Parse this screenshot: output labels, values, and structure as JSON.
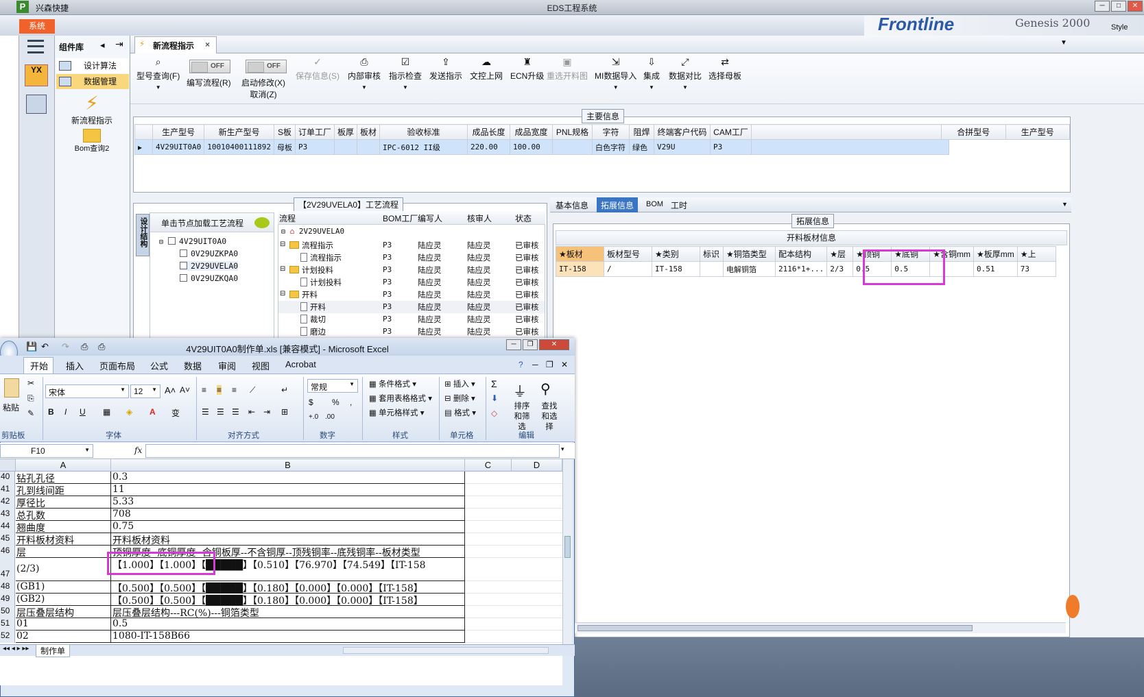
{
  "app": {
    "title": "EDS工程系统",
    "name": "兴森快捷",
    "system_button": "系统",
    "banner_text": "Frontline",
    "banner_sub": "Genesis 2000",
    "style_label": "Style"
  },
  "nav": {
    "library_label": "组件库",
    "items": [
      "设计算法",
      "数据管理"
    ],
    "launchers": [
      "新流程指示",
      "Bom查询2"
    ]
  },
  "tab": {
    "label": "新流程指示",
    "close": "×"
  },
  "toolbar": {
    "buttons": [
      {
        "label": "型号查询(F)",
        "icon": "search-icon"
      },
      {
        "label": "编写流程(R)",
        "icon": "toggle-off"
      },
      {
        "label": "启动修改(X)",
        "sub": "取消(Z)",
        "icon": "toggle-off"
      },
      {
        "label": "保存信息(S)",
        "icon": "check-icon",
        "disabled": true
      },
      {
        "label": "内部审核",
        "icon": "print-icon"
      },
      {
        "label": "指示检查",
        "icon": "check-box-icon"
      },
      {
        "label": "发送指示",
        "icon": "upload-icon"
      },
      {
        "label": "文控上网",
        "icon": "cloud-upload-icon"
      },
      {
        "label": "ECN升级",
        "icon": "ecn-icon"
      },
      {
        "label": "重选开料图",
        "icon": "image-icon",
        "disabled": true
      },
      {
        "label": "MI数据导入",
        "icon": "import-icon"
      },
      {
        "label": "集成",
        "icon": "download-icon"
      },
      {
        "label": "数据对比",
        "icon": "compare-icon"
      },
      {
        "label": "选择母板",
        "icon": "shuffle-icon"
      }
    ],
    "toggle_text": "OFF"
  },
  "main_info": {
    "title": "主要信息",
    "columns": [
      "生产型号",
      "新生产型号",
      "S板",
      "订单工厂",
      "板厚",
      "板材",
      "验收标准",
      "成品长度",
      "成品宽度",
      "PNL规格",
      "字符",
      "阻焊",
      "终端客户代码",
      "CAM工厂"
    ],
    "row": [
      "4V29UIT0A0",
      "10010400111892",
      "母板",
      "P3",
      "",
      "",
      "IPC-6012 II级",
      "220.00",
      "100.00",
      "",
      "白色字符",
      "绿色",
      "V29U",
      "P3"
    ],
    "side_columns": [
      "合拼型号",
      "生产型号"
    ]
  },
  "process": {
    "title": "【2V29UVELA0】工艺流程",
    "vertical_tab": "设计结构",
    "hint": "单击节点加载工艺流程",
    "part_tree": [
      "4V29UIT0A0",
      "0V29UZKPA0",
      "2V29UVELA0",
      "0V29UZKQA0"
    ],
    "columns": [
      "流程",
      "BOM工厂",
      "编写人",
      "核审人",
      "状态"
    ],
    "root": "2V29UVELA0",
    "rows": [
      {
        "name": "流程指示",
        "level": 1,
        "type": "folder",
        "factory": "P3",
        "writer": "陆应灵",
        "reviewer": "陆应灵",
        "status": "已审核"
      },
      {
        "name": "流程指示",
        "level": 2,
        "type": "doc",
        "factory": "P3",
        "writer": "陆应灵",
        "reviewer": "陆应灵",
        "status": "已审核"
      },
      {
        "name": "计划投料",
        "level": 1,
        "type": "folder",
        "factory": "P3",
        "writer": "陆应灵",
        "reviewer": "陆应灵",
        "status": "已审核"
      },
      {
        "name": "计划投料",
        "level": 2,
        "type": "doc",
        "factory": "P3",
        "writer": "陆应灵",
        "reviewer": "陆应灵",
        "status": "已审核"
      },
      {
        "name": "开料",
        "level": 1,
        "type": "folder",
        "factory": "P3",
        "writer": "陆应灵",
        "reviewer": "陆应灵",
        "status": "已审核"
      },
      {
        "name": "开料",
        "level": 2,
        "type": "doc",
        "factory": "P3",
        "writer": "陆应灵",
        "reviewer": "陆应灵",
        "status": "已审核"
      },
      {
        "name": "裁切",
        "level": 2,
        "type": "doc",
        "factory": "P3",
        "writer": "陆应灵",
        "reviewer": "陆应灵",
        "status": "已审核"
      },
      {
        "name": "磨边",
        "level": 2,
        "type": "doc",
        "factory": "P3",
        "writer": "陆应灵",
        "reviewer": "陆应灵",
        "status": "已审核"
      }
    ]
  },
  "right_tabs": [
    "基本信息",
    "拓展信息",
    "BOM",
    "工时"
  ],
  "ext_info": {
    "group_title": "拓展信息",
    "table_title": "开料板材信息",
    "columns": [
      "★板材",
      "板材型号",
      "★类别",
      "标识",
      "★铜箔类型",
      "配本结构",
      "★层",
      "★顶铜",
      "★底铜",
      "★含铜mm",
      "★板厚mm",
      "★上"
    ],
    "row": [
      "IT-158",
      "/",
      "IT-158",
      "",
      "电解铜箔",
      "2116*1+...",
      "2/3",
      "0.5",
      "0.5",
      "",
      "0.51",
      "73"
    ]
  },
  "excel": {
    "title": "4V29UIT0A0制作单.xls [兼容模式] - Microsoft Excel",
    "tabs": [
      "开始",
      "插入",
      "页面布局",
      "公式",
      "数据",
      "审阅",
      "视图",
      "Acrobat"
    ],
    "font_name": "宋体",
    "font_size": "12",
    "number_format": "常规",
    "groups": [
      "剪贴板",
      "字体",
      "对齐方式",
      "数字",
      "样式",
      "单元格",
      "编辑"
    ],
    "paste": "粘贴",
    "styles": [
      "条件格式",
      "套用表格格式",
      "单元格样式"
    ],
    "cells": [
      "插入",
      "删除",
      "格式"
    ],
    "edit": [
      "排序和筛选",
      "查找和选择"
    ],
    "name_box": "F10",
    "fx": "fx",
    "col_headers": [
      "A",
      "B",
      "C",
      "D"
    ],
    "rows": [
      {
        "n": "40",
        "a": "钻孔孔径",
        "b": "0.3"
      },
      {
        "n": "41",
        "a": "孔到线间距",
        "b": "11"
      },
      {
        "n": "42",
        "a": "厚径比",
        "b": "5.33"
      },
      {
        "n": "43",
        "a": "总孔数",
        "b": "708"
      },
      {
        "n": "44",
        "a": "翘曲度",
        "b": "0.75"
      },
      {
        "n": "45",
        "a": "开料板材资料",
        "b": "开料板材资料"
      },
      {
        "n": "46",
        "a": "层",
        "b": "顶铜厚度--底铜厚度--含铜板厚--不含铜厚--顶残铜率--底残铜率--板材类型"
      },
      {
        "n": "47",
        "a": "(2/3)",
        "b": "【1.000】【1.000】【█████】【0.510】【76.970】【74.549】【IT-158"
      },
      {
        "n": "48",
        "a": "(GB1)",
        "b": "【0.500】【0.500】【█████】【0.180】【0.000】【0.000】【IT-158】"
      },
      {
        "n": "49",
        "a": "(GB2)",
        "b": "【0.500】【0.500】【█████】【0.180】【0.000】【0.000】【IT-158】"
      },
      {
        "n": "50",
        "a": "层压叠层结构",
        "b": "层压叠层结构---RC(%)---铜箔类型"
      },
      {
        "n": "51",
        "a": "01",
        "b": "0.5"
      },
      {
        "n": "52",
        "a": "02",
        "b": "1080-IT-158B66"
      }
    ],
    "sheet_tab": "制作单"
  }
}
